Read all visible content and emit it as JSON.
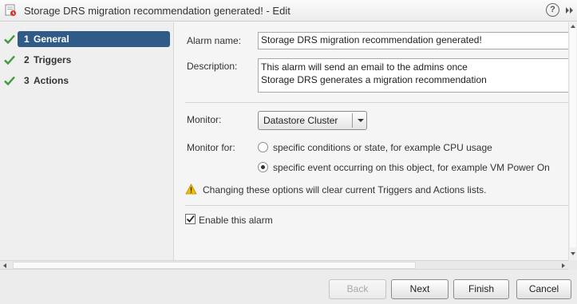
{
  "window": {
    "title": "Storage DRS migration recommendation generated! - Edit",
    "title_icon": "alarm-definition-icon",
    "help_icon": "help-icon",
    "expand_icon": "expand-icon"
  },
  "steps": [
    {
      "number": "1",
      "label": "General",
      "completed": true,
      "active": true
    },
    {
      "number": "2",
      "label": "Triggers",
      "completed": true,
      "active": false
    },
    {
      "number": "3",
      "label": "Actions",
      "completed": true,
      "active": false
    }
  ],
  "form": {
    "alarm_name_label": "Alarm name:",
    "alarm_name_value": "Storage DRS migration recommendation generated!",
    "description_label": "Description:",
    "description_lines": [
      "This alarm will send an email to the admins once",
      "Storage DRS generates a migration recommendation"
    ],
    "monitor_label": "Monitor:",
    "monitor_value": "Datastore Cluster",
    "monitor_for_label": "Monitor for:",
    "monitor_for_options": [
      {
        "label": "specific conditions or state, for example CPU usage",
        "selected": false
      },
      {
        "label": "specific event occurring on this object, for example VM Power On",
        "selected": true
      }
    ],
    "warning_text": "Changing these options will clear current Triggers and Actions lists.",
    "enable_label": "Enable this alarm",
    "enable_checked": true
  },
  "buttons": {
    "back": "Back",
    "next": "Next",
    "finish": "Finish",
    "cancel": "Cancel"
  },
  "colors": {
    "active_step": "#2f5b86",
    "check": "#3d9a3d",
    "warning": "#f2c200"
  }
}
